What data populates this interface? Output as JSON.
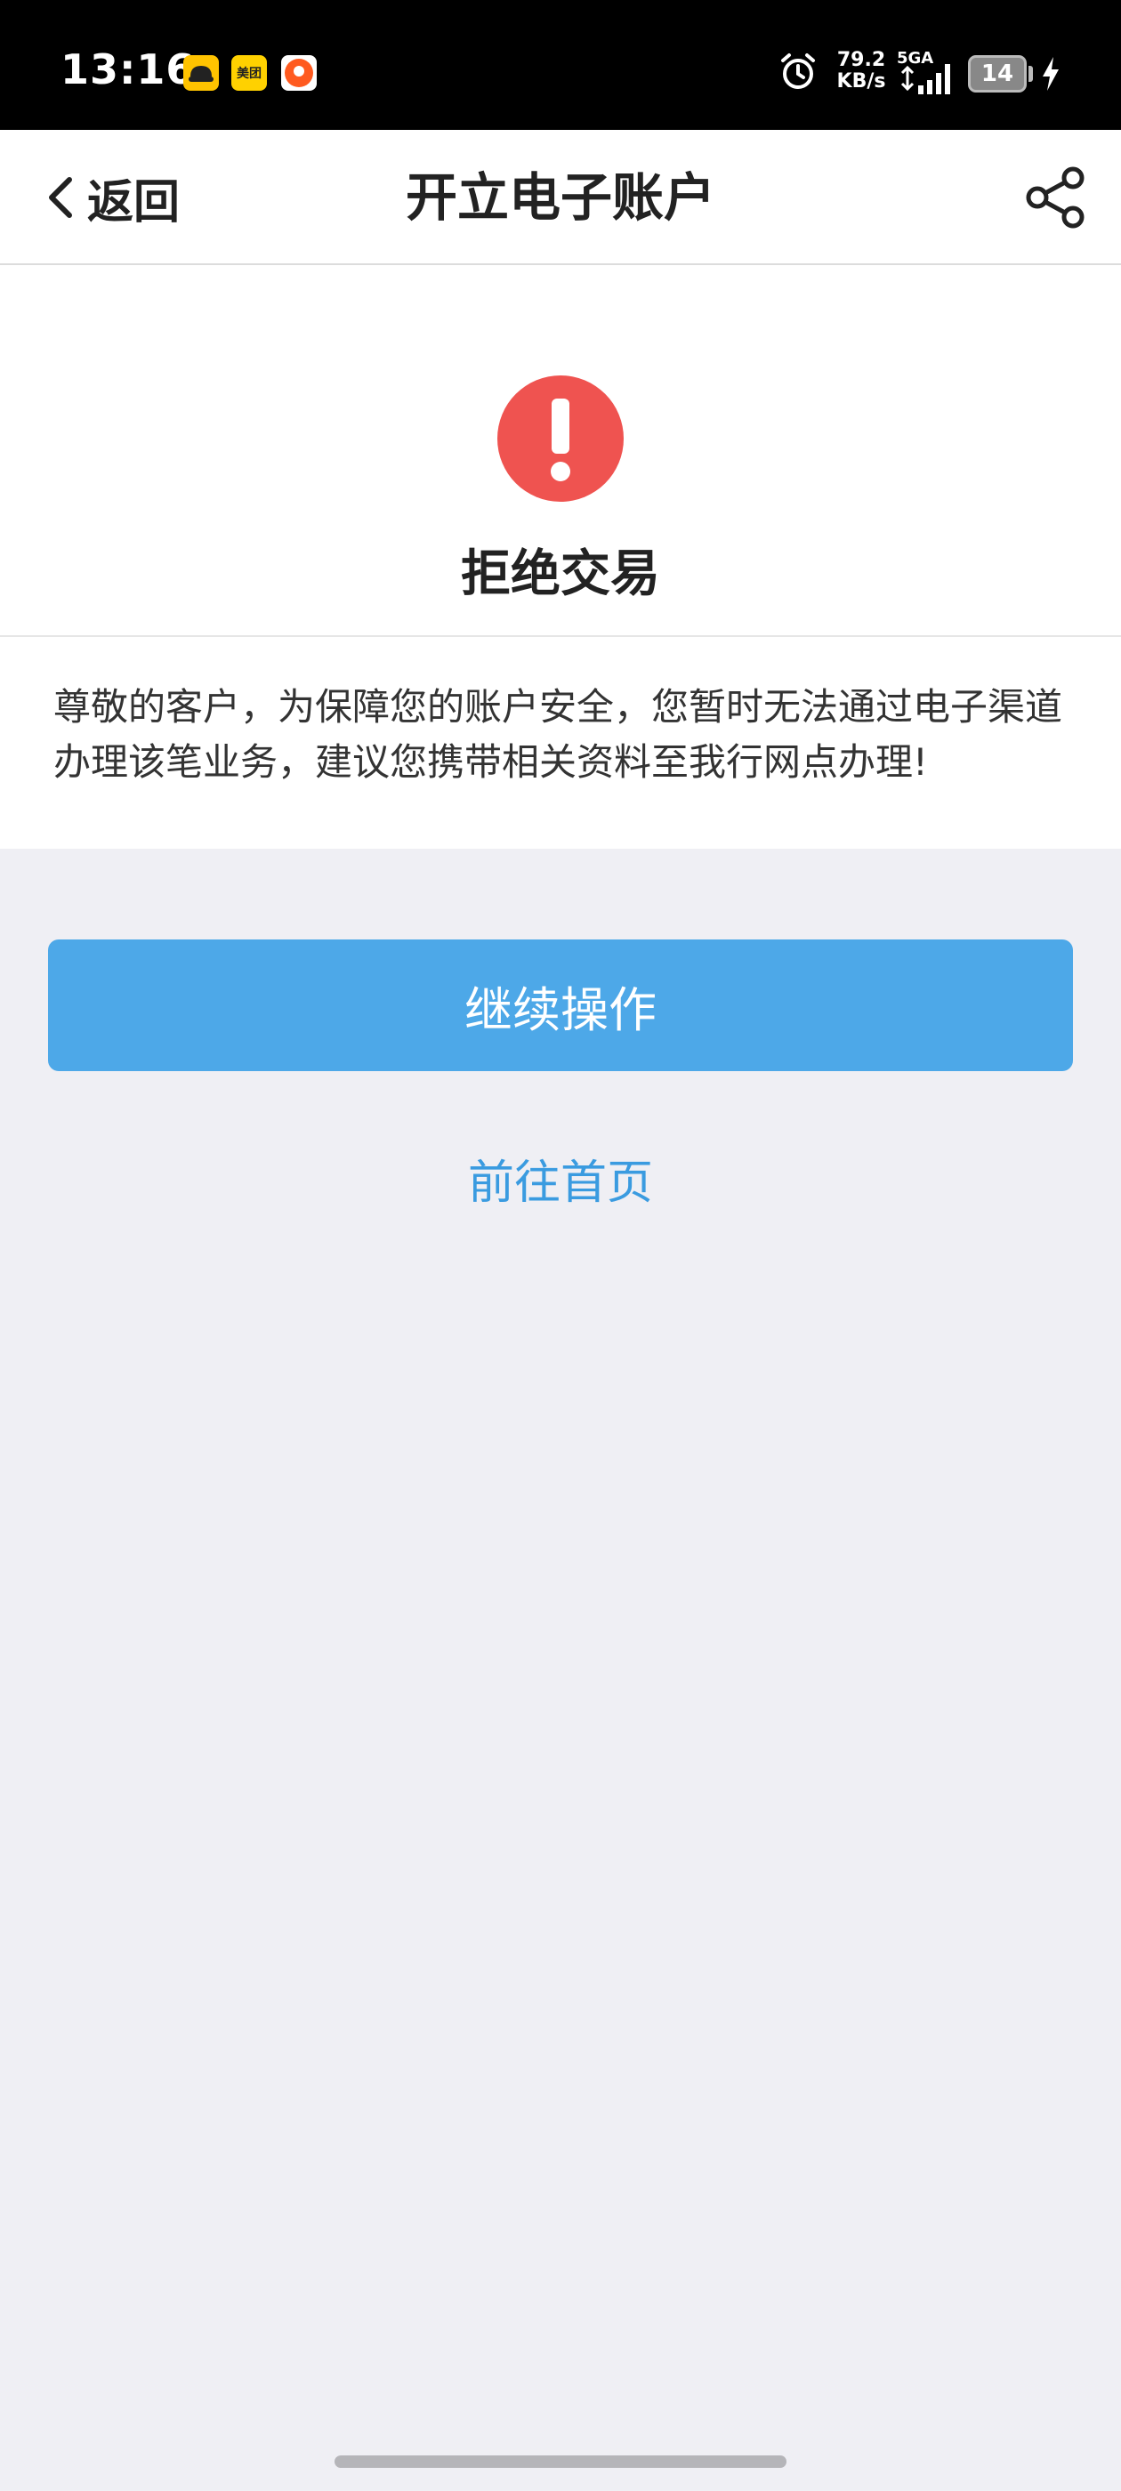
{
  "status_bar": {
    "time": "13:16",
    "meituan_label": "美团",
    "net_speed_value": "79.2",
    "net_speed_unit": "KB/s",
    "network_type": "5GA",
    "battery": "14",
    "icons": [
      "didi-icon",
      "meituan-icon",
      "taobao-icon",
      "alarm-icon",
      "signal-icon",
      "battery-icon",
      "charging-icon"
    ]
  },
  "header": {
    "back_label": "返回",
    "title": "开立电子账户",
    "share_icon": "share-icon"
  },
  "result": {
    "status_icon": "exclamation-icon",
    "status_color": "#ef5350",
    "title": "拒绝交易",
    "message": "尊敬的客户，为保障您的账户安全，您暂时无法通过电子渠道办理该笔业务，建议您携带相关资料至我行网点办理!"
  },
  "actions": {
    "continue_label": "继续操作",
    "continue_color": "#4da8e8",
    "home_label": "前往首页",
    "home_color": "#3a9be0"
  }
}
